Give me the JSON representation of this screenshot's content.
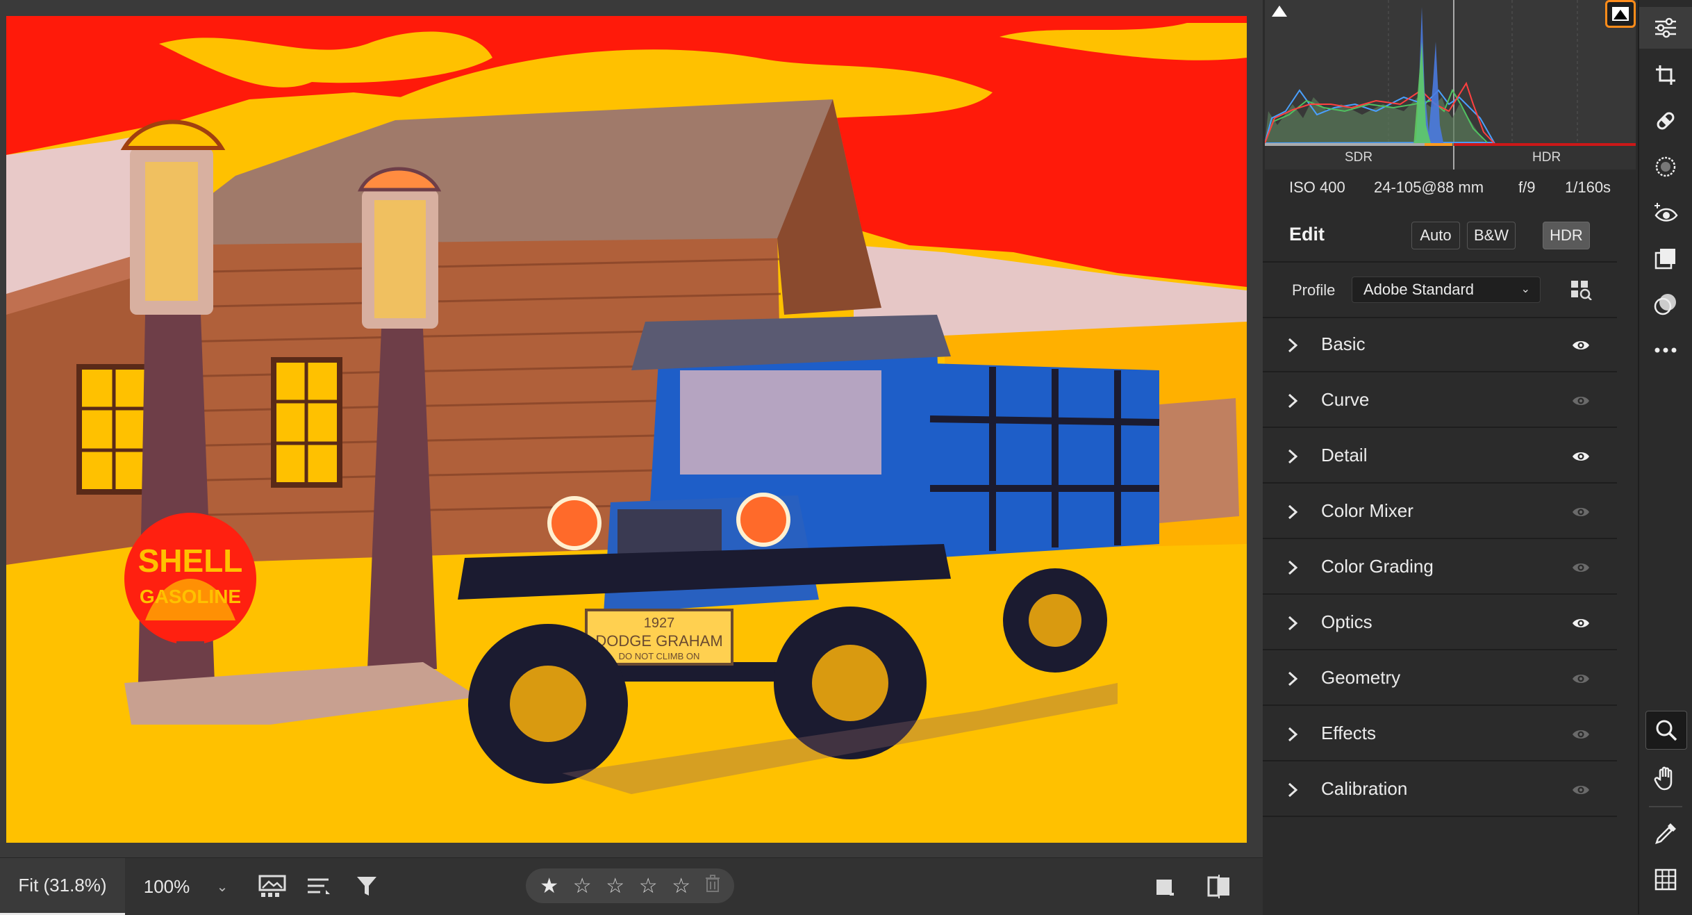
{
  "histogram": {
    "sdr_label": "SDR",
    "hdr_label": "HDR",
    "clip_left_icon": "shadow-clipping-icon",
    "clip_right_icon": "highlight-clipping-icon"
  },
  "exif": {
    "iso": "ISO 400",
    "lens": "24-105@88 mm",
    "aperture": "f/9",
    "shutter": "1/160s"
  },
  "edit": {
    "title": "Edit",
    "auto_label": "Auto",
    "bw_label": "B&W",
    "hdr_label": "HDR"
  },
  "profile": {
    "label": "Profile",
    "value": "Adobe Standard"
  },
  "sections": [
    {
      "label": "Basic",
      "visible": true
    },
    {
      "label": "Curve",
      "visible": false
    },
    {
      "label": "Detail",
      "visible": true
    },
    {
      "label": "Color Mixer",
      "visible": false
    },
    {
      "label": "Color Grading",
      "visible": false
    },
    {
      "label": "Optics",
      "visible": true
    },
    {
      "label": "Geometry",
      "visible": false
    },
    {
      "label": "Effects",
      "visible": false
    },
    {
      "label": "Calibration",
      "visible": false
    }
  ],
  "bottom_bar": {
    "fit_label": "Fit (31.8%)",
    "zoom_label": "100%",
    "rating": 1,
    "rating_max": 5
  },
  "photo_text": {
    "plate_line1": "1927",
    "plate_line2": "DODGE GRAHAM",
    "plate_line3": "DO NOT CLIMB ON",
    "sign_line1": "SHELL",
    "sign_line2": "GASOLINE"
  },
  "colors": {
    "accent_orange": "#ff8c1a",
    "panel_bg": "#2b2b2b",
    "canvas_bg": "#3a3a3a"
  }
}
